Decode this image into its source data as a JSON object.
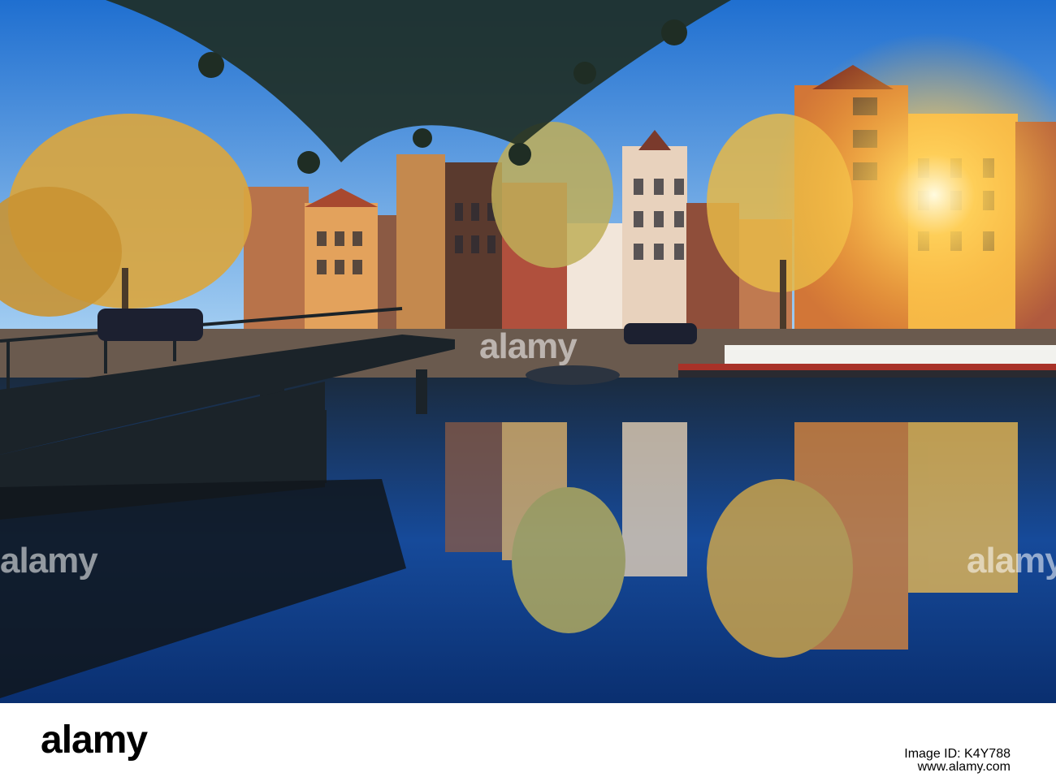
{
  "photo": {
    "description_colors": {
      "sky_top": "#2c7fd6",
      "sky_bottom": "#9cc8f0",
      "water": "#0f3a7a",
      "sun": "#fff6c0",
      "tree": "#e0a63a",
      "bridge": "#1b2329"
    }
  },
  "watermarks": {
    "left": "alamy",
    "middle": "alamy",
    "right": "alamy"
  },
  "footer": {
    "logo": "alamy",
    "image_id_label": "Image ID: K4Y788",
    "site": "www.alamy.com"
  }
}
